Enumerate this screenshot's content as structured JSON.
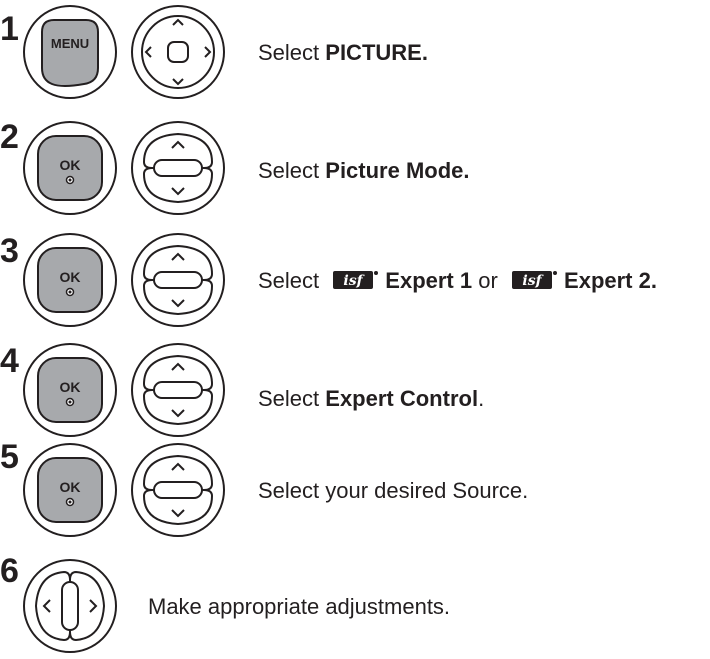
{
  "steps": [
    {
      "number": "1",
      "buttons": [
        "menu-key",
        "dpad-four-way"
      ],
      "text": {
        "prefix": "Select ",
        "bold": "PICTURE.",
        "suffix": ""
      },
      "menu_key_label": "MENU"
    },
    {
      "number": "2",
      "buttons": [
        "ok-key",
        "updown-key"
      ],
      "text": {
        "prefix": "Select ",
        "bold": "Picture Mode.",
        "suffix": ""
      },
      "ok_key_label": "OK"
    },
    {
      "number": "3",
      "buttons": [
        "ok-key",
        "updown-key"
      ],
      "text": {
        "prefix": "Select",
        "bold1": "Expert 1",
        "middle": " or ",
        "bold2": "Expert 2."
      },
      "ok_key_label": "OK",
      "logo_text": "isf"
    },
    {
      "number": "4",
      "buttons": [
        "ok-key",
        "updown-key"
      ],
      "text": {
        "prefix": "Select ",
        "bold": "Expert Control",
        "suffix": "."
      },
      "ok_key_label": "OK"
    },
    {
      "number": "5",
      "buttons": [
        "ok-key",
        "updown-key"
      ],
      "text": {
        "prefix": "Select your desired Source.",
        "bold": "",
        "suffix": ""
      },
      "ok_key_label": "OK"
    },
    {
      "number": "6",
      "buttons": [
        "leftright-key"
      ],
      "text": {
        "prefix": "Make appropriate adjustments.",
        "bold": "",
        "suffix": ""
      }
    }
  ],
  "colors": {
    "key_fill": "#a7a9ac",
    "key_border": "#231f20",
    "text": "#231f20"
  }
}
